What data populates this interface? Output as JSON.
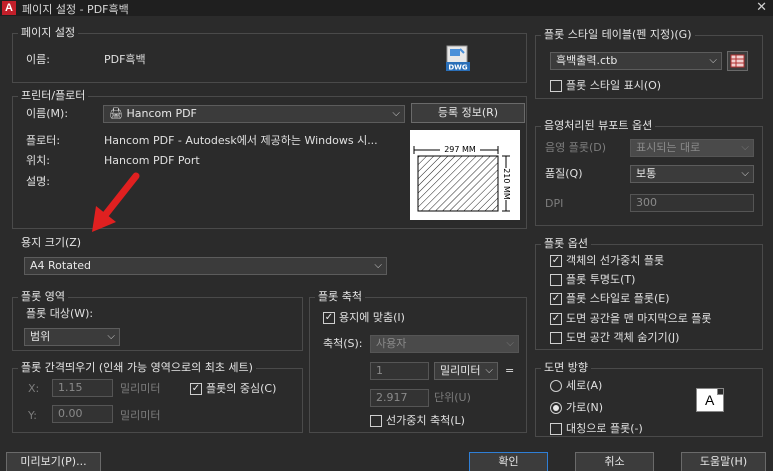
{
  "window": {
    "title": "페이지 설정 - PDF흑백",
    "close": "✕"
  },
  "page_setup": {
    "group_title": "페이지 설정",
    "name_label": "이름:",
    "name_value": "PDF흑백",
    "dwg_badge": "DWG"
  },
  "printer": {
    "group_title": "프린터/플로터",
    "name_label": "이름(M):",
    "device": "Hancom PDF",
    "properties_button": "등록 정보(R)",
    "plotter_label": "플로터:",
    "plotter_value": "Hancom PDF - Autodesk에서 제공하는 Windows 시...",
    "location_label": "위치:",
    "location_value": "Hancom PDF Port",
    "description_label": "설명:",
    "preview_width": "297 MM",
    "preview_height": "210 MM"
  },
  "paper_size": {
    "group_title": "용지 크기(Z)",
    "value": "A4 Rotated"
  },
  "plot_area": {
    "group_title": "플롯 영역",
    "what_label": "플롯 대상(W):",
    "what_value": "범위"
  },
  "plot_offset": {
    "group_title": "플롯 간격띄우기 (인쇄 가능 영역으로의 최초 세트)",
    "x_label": "X:",
    "x_value": "1.15",
    "x_unit": "밀리미터",
    "center_label": "플롯의 중심(C)",
    "center_checked": true,
    "y_label": "Y:",
    "y_value": "0.00",
    "y_unit": "밀리미터"
  },
  "plot_scale": {
    "group_title": "플롯 축척",
    "fit_label": "용지에 맞춤(I)",
    "fit_checked": true,
    "scale_label": "축척(S):",
    "scale_value": "사용자",
    "value1": "1",
    "unit_value": "밀리미터",
    "equals": "=",
    "value2": "2.917",
    "unit2": "단위(U)",
    "lineweight_label": "선가중치 축척(L)",
    "lineweight_checked": false
  },
  "plot_style_table": {
    "group_title": "플롯 스타일 테이블(펜 지정)(G)",
    "value": "흑백출력.ctb",
    "display_label": "플롯 스타일 표시(O)",
    "display_checked": false
  },
  "shaded_viewport": {
    "group_title": "음영처리된 뷰포트 옵션",
    "shade_label": "음영 플롯(D)",
    "shade_value": "표시되는 대로",
    "quality_label": "품질(Q)",
    "quality_value": "보통",
    "dpi_label": "DPI",
    "dpi_value": "300"
  },
  "plot_options": {
    "group_title": "플롯 옵션",
    "items": [
      {
        "label": "객체의 선가중치 플롯",
        "checked": true
      },
      {
        "label": "플롯 투명도(T)",
        "checked": false
      },
      {
        "label": "플롯 스타일로 플롯(E)",
        "checked": true
      },
      {
        "label": "도면 공간을 맨 마지막으로 플롯",
        "checked": true
      },
      {
        "label": "도면 공간 객체 숨기기(J)",
        "checked": false
      }
    ]
  },
  "orientation": {
    "group_title": "도면 방향",
    "portrait_label": "세로(A)",
    "landscape_label": "가로(N)",
    "selected": "landscape",
    "upside_down_label": "대칭으로 플롯(-)",
    "upside_down_checked": false,
    "icon_letter": "A"
  },
  "buttons": {
    "preview": "미리보기(P)...",
    "ok": "확인",
    "cancel": "취소",
    "help": "도움말(H)"
  },
  "colors": {
    "background": "#2b2b2b",
    "accent_border": "#2f7fd6",
    "annotation_arrow": "#e02020"
  }
}
